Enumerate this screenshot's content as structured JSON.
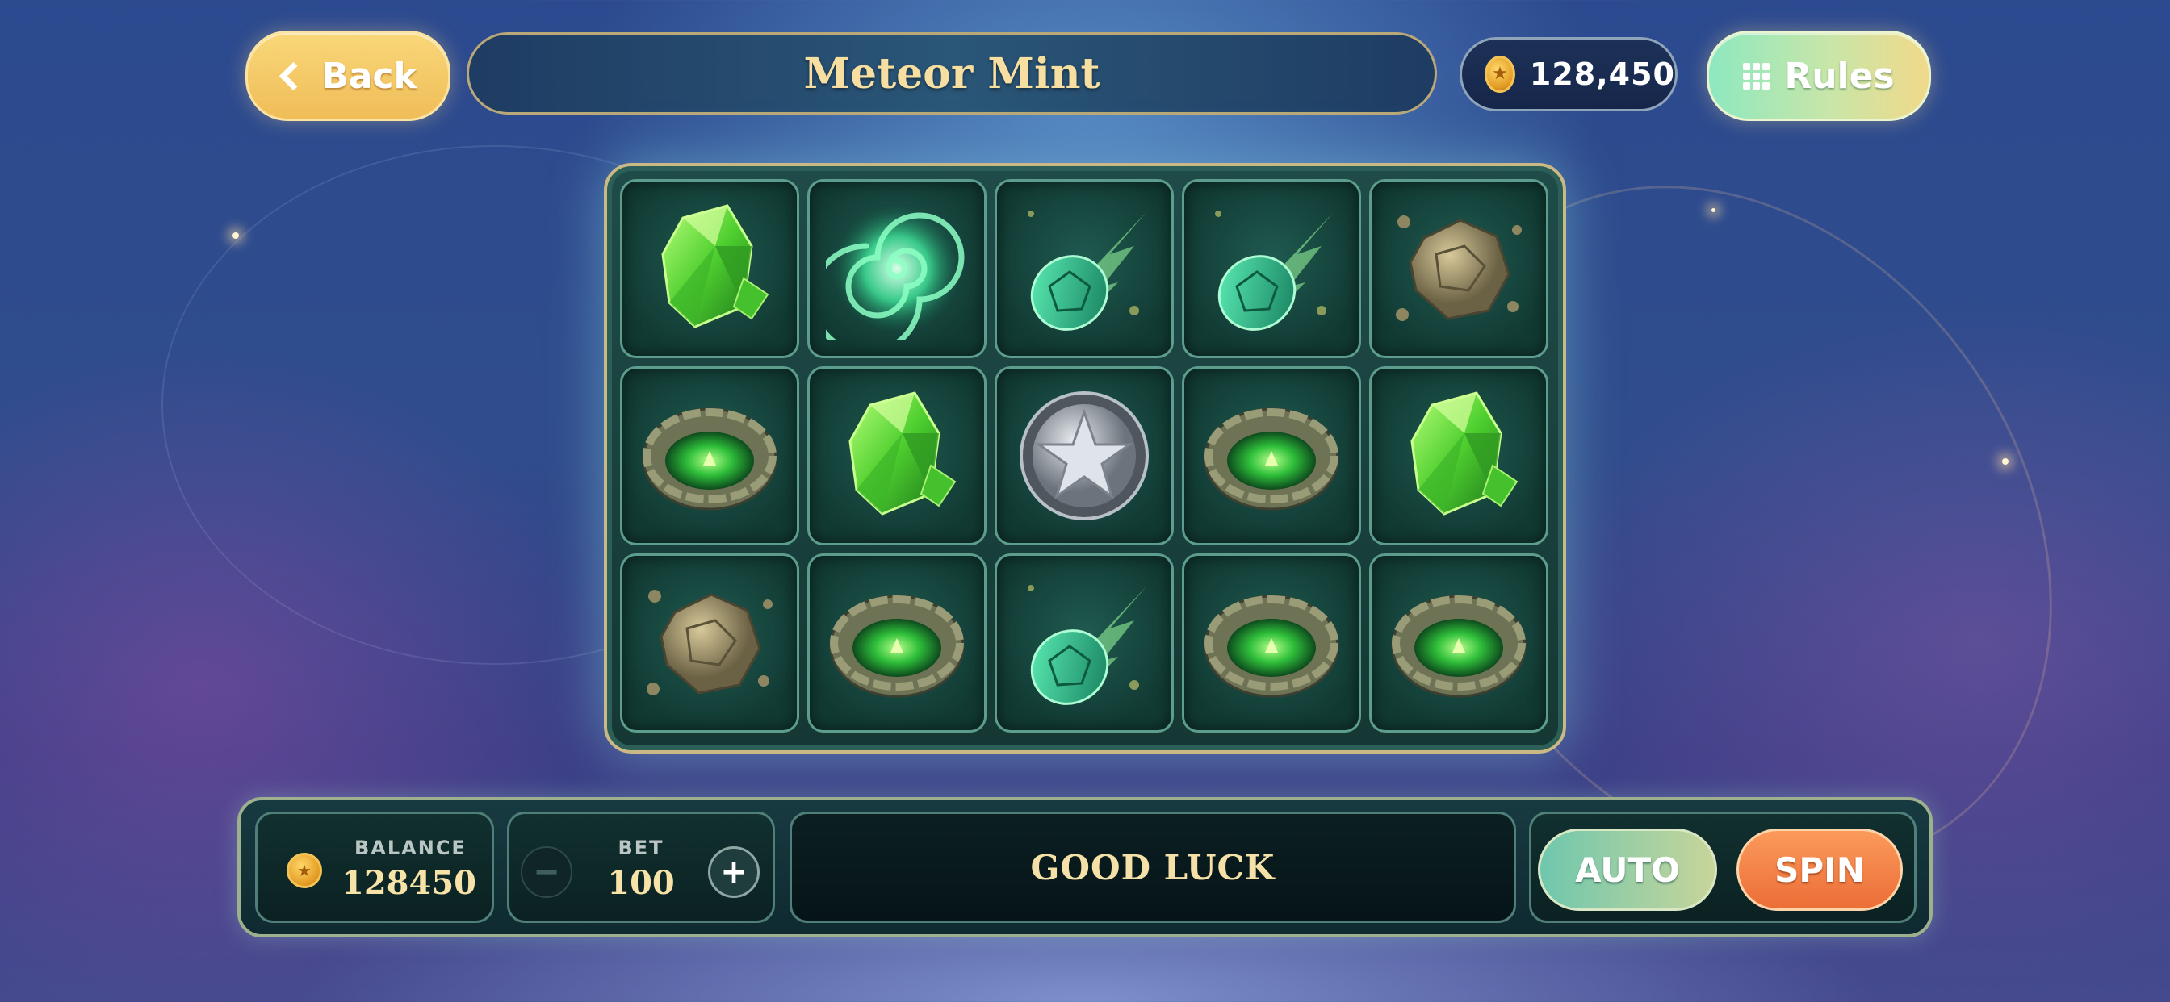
{
  "header": {
    "back_label": "Back",
    "title": "Meteor Mint",
    "coins": "128,450",
    "rules_label": "Rules"
  },
  "icons": {
    "back": "chevron-left-icon",
    "coin": "coin-icon",
    "rules": "grid-icon"
  },
  "reels": {
    "rows": [
      [
        "emerald-crystal",
        "green-vortex",
        "green-meteor",
        "green-meteor",
        "asteroid-rock"
      ],
      [
        "stone-crater",
        "emerald-crystal",
        "silver-star-shield",
        "stone-crater",
        "emerald-crystal"
      ],
      [
        "asteroid-rock",
        "stone-crater",
        "green-meteor",
        "stone-crater",
        "stone-crater"
      ]
    ]
  },
  "controls": {
    "balance_label": "BALANCE",
    "balance_value": "128450",
    "bet_label": "BET",
    "bet_value": "100",
    "minus_label": "−",
    "plus_label": "+",
    "message": "GOOD LUCK",
    "auto_label": "AUTO",
    "spin_label": "SPIN"
  },
  "colors": {
    "back_button": "#f3c35e",
    "rules_button": "#a6e3bd",
    "spin_button": "#f27c41",
    "auto_button": "#9ccfa8",
    "title_text": "#f6dfa0",
    "cell_border": "#5c9d8d"
  }
}
